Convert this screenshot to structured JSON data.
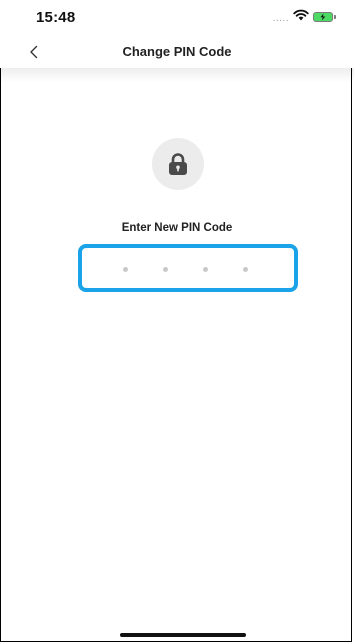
{
  "status_bar": {
    "time": "15:48",
    "signal": ".....",
    "wifi_icon": "wifi-icon",
    "battery_icon": "battery-charging-icon"
  },
  "nav": {
    "back_icon": "chevron-left-icon",
    "title": "Change PIN Code"
  },
  "lock": {
    "icon": "lock-icon"
  },
  "pin": {
    "prompt": "Enter New PIN Code",
    "length": 4,
    "entered": 0
  },
  "colors": {
    "accent": "#1aa3e8",
    "battery_fill": "#4cd964",
    "dot_empty": "#c9c9c9",
    "lock_bg": "#ececec"
  }
}
